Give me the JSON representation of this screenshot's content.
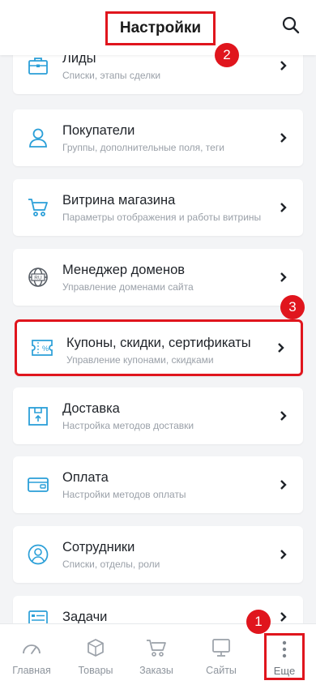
{
  "header": {
    "title": "Настройки"
  },
  "badges": {
    "one": "1",
    "two": "2",
    "three": "3"
  },
  "settings": [
    {
      "title": "Лиды",
      "subtitle": "Списки, этапы сделки",
      "icon": "briefcase-icon"
    },
    {
      "title": "Покупатели",
      "subtitle": "Группы, дополнительные поля, теги",
      "icon": "user-icon"
    },
    {
      "title": "Витрина магазина",
      "subtitle": "Параметры отображения и работы витрины",
      "icon": "cart-icon"
    },
    {
      "title": "Менеджер доменов",
      "subtitle": "Управление доменами сайта",
      "icon": "globe-icon"
    },
    {
      "title": "Купоны, скидки, сертификаты",
      "subtitle": "Управление купонами, скидками",
      "icon": "coupon-icon"
    },
    {
      "title": "Доставка",
      "subtitle": "Настройка методов доставки",
      "icon": "box-icon"
    },
    {
      "title": "Оплата",
      "subtitle": "Настройки методов оплаты",
      "icon": "wallet-icon"
    },
    {
      "title": "Сотрудники",
      "subtitle": "Списки, отделы, роли",
      "icon": "employee-icon"
    },
    {
      "title": "Задачи",
      "subtitle": "",
      "icon": "tasks-icon"
    }
  ],
  "nav": [
    {
      "label": "Главная",
      "icon": "dashboard-icon"
    },
    {
      "label": "Товары",
      "icon": "products-icon"
    },
    {
      "label": "Заказы",
      "icon": "orders-icon"
    },
    {
      "label": "Сайты",
      "icon": "monitor-icon"
    },
    {
      "label": "Еще",
      "icon": "more-dots-icon"
    }
  ],
  "colors": {
    "accent": "#2a9fd8",
    "highlight": "#e0151d",
    "nav_icon": "#9aa0a8"
  }
}
